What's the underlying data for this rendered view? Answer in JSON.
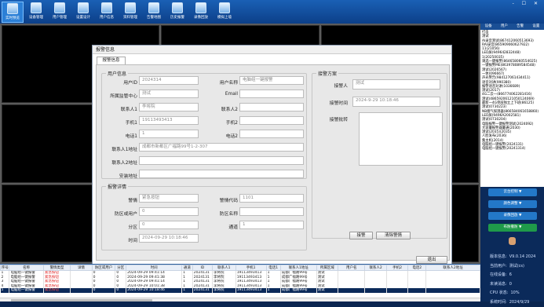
{
  "toolbar": {
    "items": [
      {
        "label": "实时预览",
        "icon": "camera-icon"
      },
      {
        "label": "设备管理",
        "icon": "device-icon"
      },
      {
        "label": "用户管理",
        "icon": "user-icon"
      },
      {
        "label": "设置设计",
        "icon": "settings-icon"
      },
      {
        "label": "用户信息",
        "icon": "user-info-icon"
      },
      {
        "label": "资料管理",
        "icon": "data-icon"
      },
      {
        "label": "告警地图",
        "icon": "map-icon"
      },
      {
        "label": "历史报警",
        "icon": "history-icon"
      },
      {
        "label": "录像回放",
        "icon": "playback-icon"
      },
      {
        "label": "模拟上墙",
        "icon": "wall-icon"
      }
    ],
    "window_controls": "- ☐ ✕"
  },
  "dialog": {
    "title": "报警信息",
    "tab": "报警信息",
    "user_group": {
      "title": "用户信息",
      "user_id_label": "用户ID",
      "user_id": "2024314",
      "user_name_label": "用户名称",
      "user_name": "电脑组一键报警",
      "center_label": "所属监管中心",
      "center": "测试",
      "email_label": "Email",
      "email": "",
      "contact1_label": "联系人1",
      "contact1": "李将院",
      "contact2_label": "联系人2",
      "contact2": "",
      "mobile1_label": "手机1",
      "mobile1": "19113493413",
      "mobile2_label": "手机2",
      "mobile2": "",
      "phone1_label": "电话1",
      "phone1": "1",
      "phone2_label": "电话2",
      "phone2": "",
      "addr1_label": "联系人1地址",
      "addr1": "成都市新都区广福路99号1-2-307",
      "addr2_label": "联系人2地址",
      "addr2": "",
      "install_label": "安装地址",
      "install": ""
    },
    "alarm_detail": {
      "title": "报警详情",
      "alarm_label": "警情",
      "alarm": "紧急按钮",
      "code_label": "警情代码",
      "code": "1101",
      "zone_user_label": "防区或用户",
      "zone_user": "0",
      "zone_name_label": "防区名称",
      "zone_name": "",
      "partition_label": "分区",
      "partition": "0",
      "channel_label": "通道",
      "channel": "1",
      "time_label": "时间",
      "time": "2024-09-29 10:18:46"
    },
    "handling": {
      "title": "接警方案",
      "person_label": "接警人",
      "person": "测试",
      "recv_time_label": "接警时间",
      "recv_time": "2024-9-29 10:18:46",
      "notes_label": "接警批转",
      "notes": "",
      "accept_btn": "接警",
      "clear_btn": "清除警情"
    },
    "exit_btn": "退出"
  },
  "right_panel": {
    "tabs": [
      "设备",
      "用户",
      "告警",
      "设置"
    ],
    "list": [
      "打击",
      "测试",
      "AI录音测试(867412060513693)",
      "RAI录音(865909060627922)",
      "11(21056)",
      "LED屏(949642832448)",
      "1(20250035)",
      "请选一键报警(864658060554025)",
      "一键报警ME(863978089584548)",
      "测试(2026567)",
      "一体(096667)",
      "声光警告(984127061434411)",
      "语音对讲(990380)",
      "报警语音对讲(1036689)",
      "测试(2017)",
      "4G二云一(866774062281416)",
      "测试(48659206121050124069)",
      "最新一4G单层独立上下班(86125)",
      "测试(0730223)",
      "NB烟气探测器(866584061658860)",
      "LED屏(9496A2002581)",
      "测试(0730204)",
      "电脑报警一键报警测试(2024092)",
      "大容量报警器量通(2030)",
      "测试(2035)(2035)",
      "人脸发布(2036)",
      "集主机(2014)",
      "电脑组一键报警(2024131)",
      "电脑组一键报警(20241314)"
    ],
    "buttons": [
      {
        "label": "云台控制 ▼",
        "color": "#2378c8"
      },
      {
        "label": "颜色调整 ▼",
        "color": "#2378c8"
      },
      {
        "label": "录像回放 ▼",
        "color": "#2378c8"
      },
      {
        "label": "布防撤防 ▼",
        "color": "#1f9a4a"
      }
    ],
    "sysinfo": {
      "version_label": "版本信息:",
      "version": "V9.0.14 2024",
      "user_label": "当前用户:",
      "user": "测试(cs)",
      "online_label": "在线设备:",
      "online": "6",
      "unhandled_label": "未读消息:",
      "unhandled": "0",
      "cpu_label": "CPU 状态:",
      "cpu": "10%",
      "time_label": "系统时间:",
      "time": "2024/9/29"
    }
  },
  "bottom_table": {
    "headers": [
      "序号",
      "名称",
      "警情类型",
      "详情",
      "防区或用户",
      "分区",
      "时间",
      "通道",
      "ID",
      "联系人1",
      "手机1",
      "电话1",
      "联系人1地址",
      "所属区域",
      "用户名",
      "联系人2",
      "手机2",
      "电话2",
      "联系人2地址"
    ],
    "rows": [
      [
        "1",
        "电脑组一键报警",
        "紧急按钮",
        "",
        "0",
        "0",
        "2024-09-29 09:41:14",
        "1",
        "2024131",
        "李将院",
        "19113493413",
        "1",
        "成都广福路99号",
        "测试",
        "",
        "",
        "",
        "",
        ""
      ],
      [
        "2",
        "电脑组一键报警",
        "紧急按钮",
        "",
        "0",
        "0",
        "2024-09-29 09:41:38",
        "1",
        "2024131",
        "李将院",
        "19113493413",
        "1",
        "成都广福路99号",
        "测试",
        "",
        "",
        "",
        "",
        ""
      ],
      [
        "3",
        "电脑组一键报警",
        "紧急按钮",
        "",
        "0",
        "0",
        "2024-09-29 09:41:14",
        "1",
        "2024131",
        "李将院",
        "19113493413",
        "1",
        "成都广福路99号",
        "测试",
        "",
        "",
        "",
        "",
        ""
      ],
      [
        "4",
        "电脑组一键报警",
        "紧急按钮",
        "",
        "0",
        "0",
        "2024-09-29 10:01:38",
        "1",
        "2024131",
        "李将院",
        "19113493413",
        "1",
        "成都广福路99号",
        "测试",
        "",
        "",
        "",
        "",
        ""
      ],
      [
        "5",
        "电脑组一键报警",
        "紧急按钮",
        "",
        "0",
        "0",
        "2024-09-29 10:18:46",
        "1",
        "2024131",
        "李将院",
        "19113493413",
        "1",
        "成都广福路99号",
        "测试",
        "",
        "",
        "",
        "",
        ""
      ]
    ]
  }
}
